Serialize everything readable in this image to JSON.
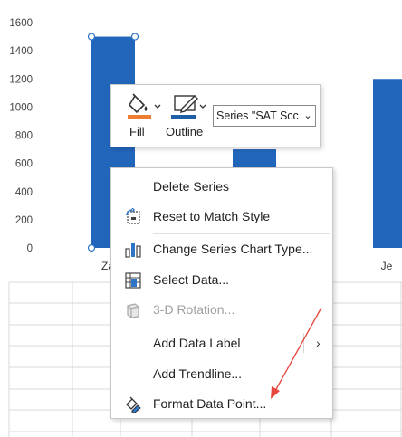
{
  "chart_data": {
    "type": "bar",
    "categories": [
      "Za",
      "",
      "Je"
    ],
    "series": [
      {
        "values": [
          1500,
          700,
          1200
        ],
        "color": "#2266bb"
      }
    ],
    "yticks": [
      0,
      200,
      400,
      600,
      800,
      1000,
      1200,
      1400,
      1600
    ],
    "ylim": [
      0,
      1600
    ],
    "grid": false,
    "selected_point_index": 0
  },
  "mini_toolbar": {
    "fill_label": "Fill",
    "outline_label": "Outline",
    "fill_color": "#ed7d31",
    "outline_color": "#1f5fa8",
    "series_select_value": "Series \"SAT Scc"
  },
  "context_menu": {
    "items": [
      {
        "label": "Delete Series",
        "icon": "none",
        "enabled": true
      },
      {
        "label": "Reset to Match Style",
        "icon": "reset-style-icon",
        "enabled": true
      },
      {
        "label": "Change Series Chart Type...",
        "icon": "chart-type-icon",
        "enabled": true
      },
      {
        "label": "Select Data...",
        "icon": "select-data-icon",
        "enabled": true
      },
      {
        "label": "3-D Rotation...",
        "icon": "rotation-3d-icon",
        "enabled": false
      },
      {
        "label": "Add Data Label",
        "icon": "none",
        "enabled": true,
        "submenu": true
      },
      {
        "label": "Add Trendline...",
        "icon": "none",
        "enabled": true
      },
      {
        "label": "Format Data Point...",
        "icon": "format-data-point-icon",
        "enabled": true
      }
    ]
  },
  "annotation": {
    "arrow_color": "#e8453c"
  }
}
